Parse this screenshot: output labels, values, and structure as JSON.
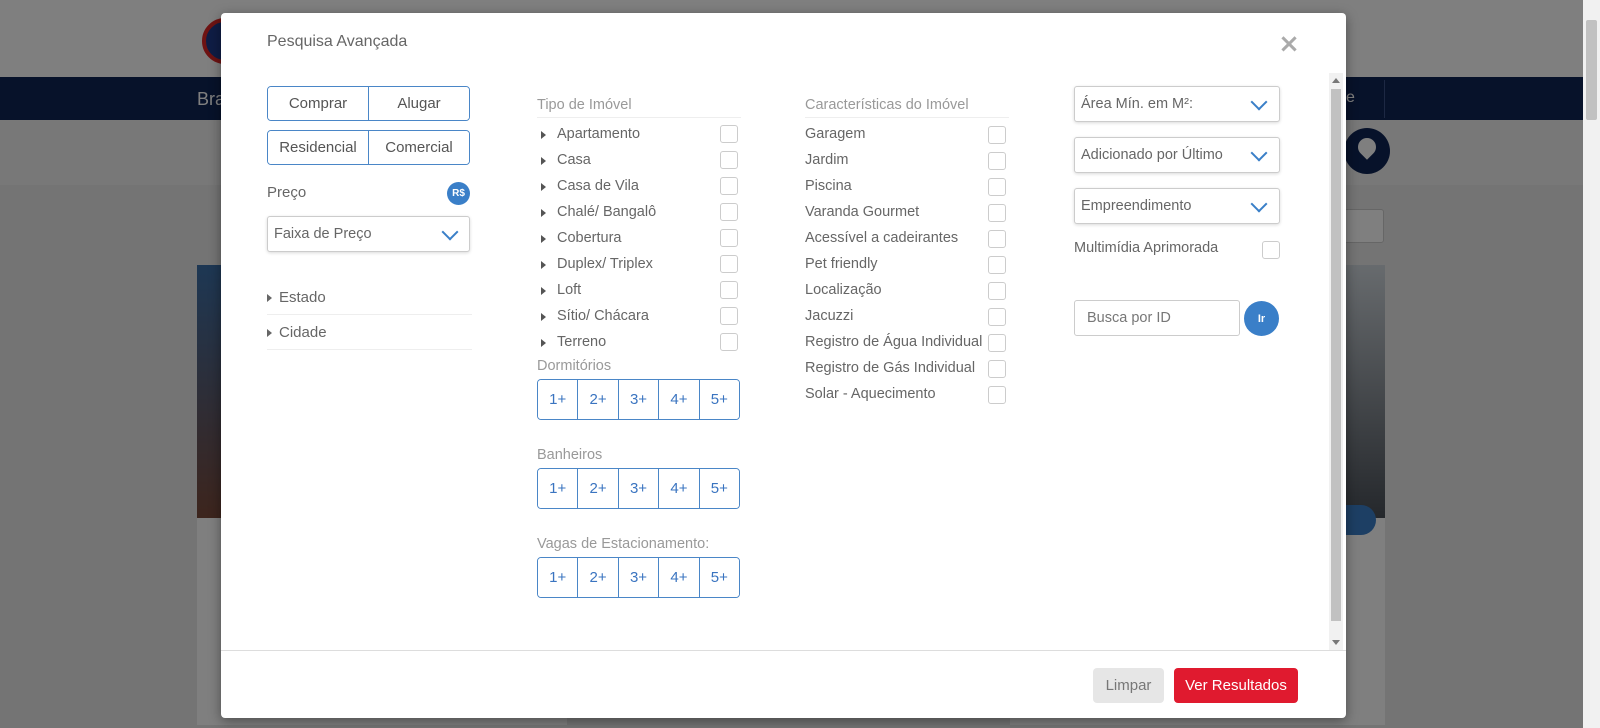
{
  "background": {
    "nav_left": "Bra",
    "nav_right": "e"
  },
  "modal": {
    "title": "Pesquisa Avançada",
    "close_icon": "×",
    "transaction": [
      "Comprar",
      "Alugar"
    ],
    "use": [
      "Residencial",
      "Comercial"
    ],
    "price_label": "Preço",
    "currency_badge": "R$",
    "price_select": "Faixa de Preço",
    "location": [
      "Estado",
      "Cidade"
    ],
    "property_type_label": "Tipo de Imóvel",
    "property_types": [
      "Apartamento",
      "Casa",
      "Casa de Vila",
      "Chalé/ Bangalô",
      "Cobertura",
      "Duplex/ Triplex",
      "Loft",
      "Sítio/ Chácara",
      "Terreno"
    ],
    "bedrooms_label": "Dormitórios",
    "bathrooms_label": "Banheiros",
    "parking_label": "Vagas de Estacionamento:",
    "counts": [
      "1+",
      "2+",
      "3+",
      "4+",
      "5+"
    ],
    "features_label": "Características do Imóvel",
    "features": [
      "Garagem",
      "Jardim",
      "Piscina",
      "Varanda Gourmet",
      "Acessível a cadeirantes",
      "Pet friendly",
      "Localização",
      "Jacuzzi",
      "Registro de Água Individual",
      "Registro de Gás Individual",
      "Solar - Aquecimento"
    ],
    "area_select": "Área Mín. em M²:",
    "sort_select": "Adicionado por Último",
    "development_select": "Empreendimento",
    "multimedia_label": "Multimídia Aprimorada",
    "search_placeholder": "Busca por ID",
    "go_button": "Ir",
    "clear_button": "Limpar",
    "results_button": "Ver Resultados"
  },
  "colors": {
    "accent": "#3a7fc8",
    "primary_action": "#e01a2f",
    "nav": "#0f2454"
  }
}
